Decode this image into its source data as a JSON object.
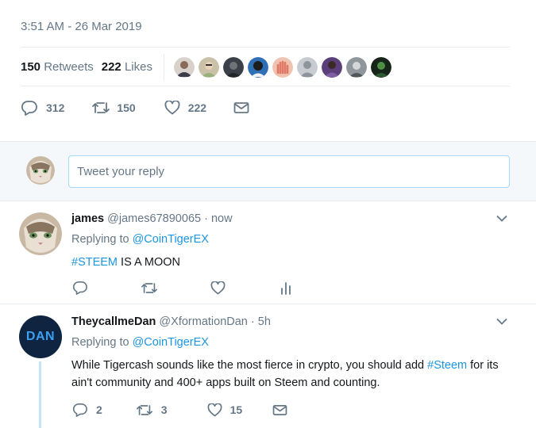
{
  "tweet": {
    "timestamp": "3:51 AM - 26 Mar 2019",
    "retweets_count": "150",
    "retweets_label": "Retweets",
    "likes_count": "222",
    "likes_label": "Likes",
    "liker_avatars": [
      {
        "color": "#8a6a58"
      },
      {
        "color": "#c9c2a8"
      },
      {
        "color": "#3a3f48"
      },
      {
        "color": "#2f6fb5"
      },
      {
        "color": "#e07a67"
      },
      {
        "color": "#c8ccd2"
      },
      {
        "color": "#5b3f7a"
      },
      {
        "color": "#8f969c"
      },
      {
        "color": "#16241a"
      }
    ],
    "actions": {
      "replies": "312",
      "retweets": "150",
      "likes": "222"
    }
  },
  "reply_box": {
    "placeholder": "Tweet your reply"
  },
  "replies": [
    {
      "name": "james",
      "handle": "@james67890065",
      "time": "now",
      "replying_prefix": "Replying to",
      "replying_to": "@CoinTigerEX",
      "hashtag": "#STEEM",
      "text": "IS A MOON"
    },
    {
      "name": "TheycallmeDan",
      "handle": "@XformationDan",
      "time": "5h",
      "avatar_text": "DAN",
      "replying_prefix": "Replying to",
      "replying_to": "@CoinTigerEX",
      "text_before": "While Tigercash sounds like the most fierce in crypto, you should add",
      "hashtag": "#Steem",
      "text_after": "for its ain't community and 400+ apps built on Steem and counting.",
      "replies": "2",
      "retweets": "3",
      "likes": "15"
    }
  ],
  "colors": {
    "accent": "#1b95e0",
    "muted": "#657786",
    "border": "#e6ecf0",
    "thread_line": "#c4e4f7"
  }
}
